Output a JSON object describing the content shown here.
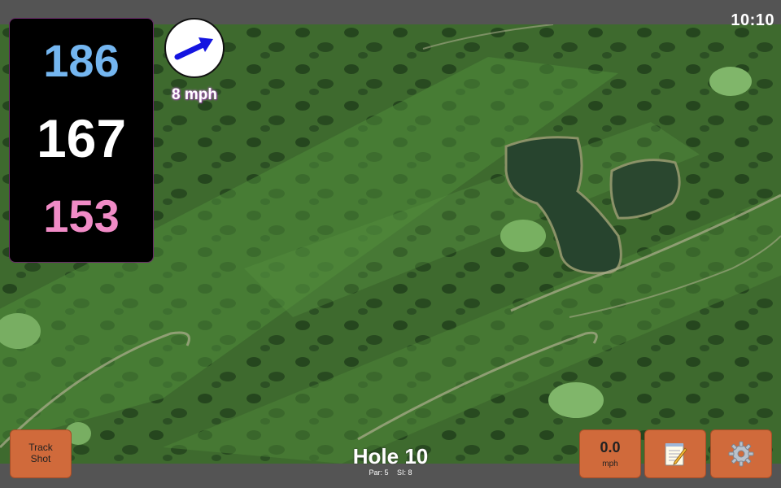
{
  "status": {
    "time": "10:10"
  },
  "distances": {
    "back": "186",
    "middle": "167",
    "front": "153"
  },
  "wind": {
    "speed_label": "8 mph",
    "direction_icon": "wind-arrow-icon"
  },
  "hole": {
    "title": "Hole 10",
    "par": "Par: 5",
    "stroke_index": "SI: 8"
  },
  "buttons": {
    "track_shot_line1": "Track",
    "track_shot_line2": "Shot",
    "speed_value": "0.0",
    "speed_unit": "mph",
    "notes_icon": "notepad-icon",
    "settings_icon": "gear-icon"
  },
  "colors": {
    "back": "#74b6f0",
    "middle": "#ffffff",
    "front": "#f08bc6",
    "button": "#d06a3b",
    "panel": "#000000"
  }
}
